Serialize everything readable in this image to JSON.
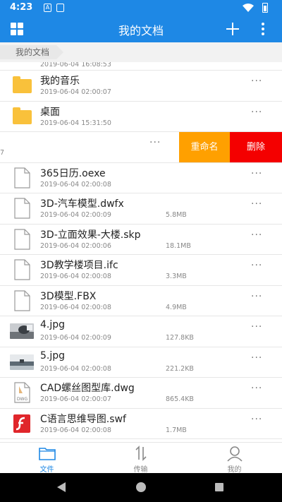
{
  "status_bar": {
    "time": "4:23",
    "icon_a": "A"
  },
  "app_bar": {
    "title": "我的文档"
  },
  "breadcrumb": {
    "label": "我的文档"
  },
  "list": {
    "partial_top": {
      "date": "2019-06-04 16:08:53"
    },
    "folders": [
      {
        "name": "我的音乐",
        "date": "2019-06-04 02:00:07"
      },
      {
        "name": "桌面",
        "date": "2019-06-04 15:31:50"
      }
    ],
    "swiped_row": {
      "edge_text": "7",
      "rename_label": "重命名",
      "delete_label": "删除"
    },
    "files": [
      {
        "name": "365日历.oexe",
        "date": "2019-06-04 02:00:08",
        "size": ""
      },
      {
        "name": "3D-汽车模型.dwfx",
        "date": "2019-06-04 02:00:09",
        "size": "5.8MB"
      },
      {
        "name": "3D-立面效果-大楼.skp",
        "date": "2019-06-04 02:00:06",
        "size": "18.1MB"
      },
      {
        "name": "3D教学楼项目.ifc",
        "date": "2019-06-04 02:00:08",
        "size": "3.3MB"
      },
      {
        "name": "3D模型.FBX",
        "date": "2019-06-04 02:00:08",
        "size": "4.9MB"
      },
      {
        "name": "4.jpg",
        "date": "2019-06-04 02:00:09",
        "size": "127.8KB"
      },
      {
        "name": "5.jpg",
        "date": "2019-06-04 02:00:08",
        "size": "221.2KB"
      },
      {
        "name": "CAD螺丝图型库.dwg",
        "date": "2019-06-04 02:00:07",
        "size": "865.4KB",
        "badge": "DWG"
      },
      {
        "name": "C语言思维导图.swf",
        "date": "2019-06-04 02:00:08",
        "size": "1.7MB"
      }
    ]
  },
  "tab_bar": {
    "tabs": [
      {
        "label": "文件",
        "icon": "folder-icon"
      },
      {
        "label": "传输",
        "icon": "transfer-icon"
      },
      {
        "label": "我的",
        "icon": "profile-icon"
      }
    ]
  },
  "colors": {
    "primary": "#1E88E5",
    "rename": "#FFA000",
    "delete": "#F40000",
    "folder": "#F9C13B"
  }
}
